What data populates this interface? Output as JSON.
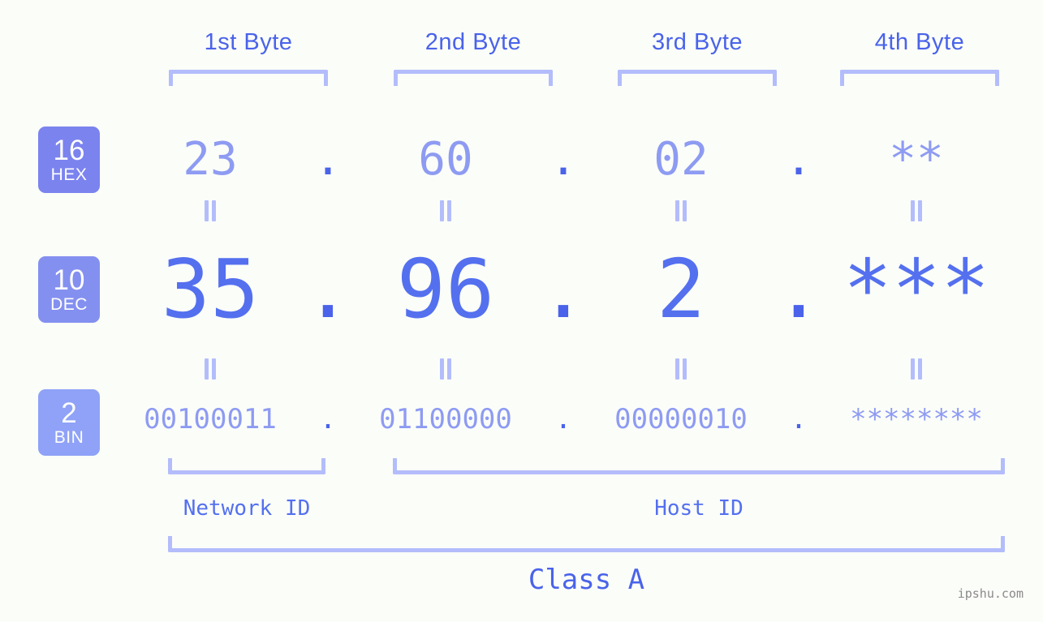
{
  "background_color": "#fbfdf9",
  "accent_color": "#4a63ea",
  "muted_accent_color": "#8e9bf2",
  "bracket_color": "#b3bdfb",
  "byte_headers": [
    {
      "label": "1st Byte"
    },
    {
      "label": "2nd Byte"
    },
    {
      "label": "3rd Byte"
    },
    {
      "label": "4th Byte"
    }
  ],
  "bases": {
    "hex": {
      "number": "16",
      "name": "HEX",
      "color": "#7b83ef"
    },
    "dec": {
      "number": "10",
      "name": "DEC",
      "color": "#8490f0"
    },
    "bin": {
      "number": "2",
      "name": "BIN",
      "color": "#8fa2f7"
    }
  },
  "rows": {
    "hex": {
      "values": [
        "23",
        "60",
        "02",
        "**"
      ],
      "separator": "."
    },
    "dec": {
      "values": [
        "35",
        "96",
        "2",
        "***"
      ],
      "separator": "."
    },
    "bin": {
      "values": [
        "00100011",
        "01100000",
        "00000010",
        "********"
      ],
      "separator": "."
    }
  },
  "equals_symbol": "=",
  "sections": {
    "network_id": "Network ID",
    "host_id": "Host ID",
    "class": "Class A"
  },
  "watermark": "ipshu.com"
}
